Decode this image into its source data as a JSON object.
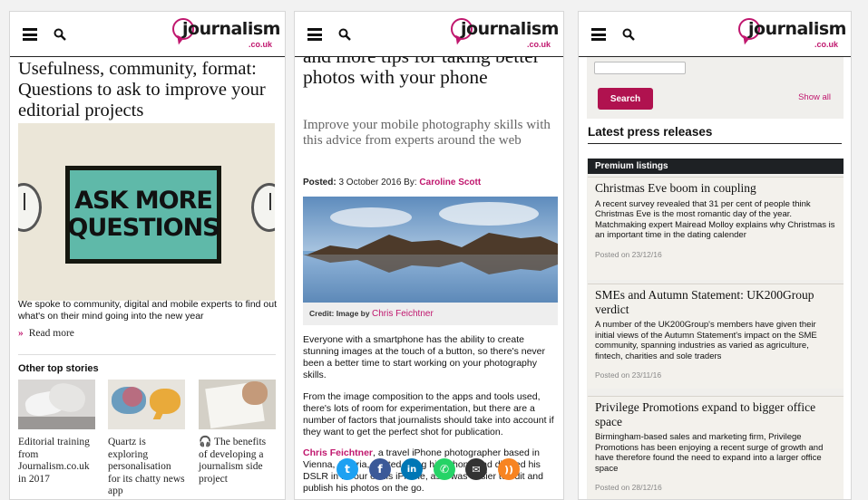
{
  "brand": {
    "name": "journalism",
    "tld": ".co.uk"
  },
  "panel1": {
    "headline": "Usefulness, community, format: Questions to ask to improve your editorial projects",
    "poster_text": [
      "ASK MORE",
      "QUESTIONS"
    ],
    "description": "We spoke to community, digital and mobile experts to find out what's on their mind going into the new year",
    "read_more": "Read more",
    "other_heading": "Other top stories",
    "stories": [
      {
        "title": "Editorial training from Journalism.co.uk in 2017"
      },
      {
        "title": "Quartz is exploring personalisation for its chatty news app"
      },
      {
        "title": "The benefits of developing a journalism side project",
        "icon": "headphones-icon"
      }
    ]
  },
  "panel2": {
    "title": "and more tips for taking better photos with your phone",
    "subtitle": "Improve your mobile photography skills with this advice from experts around the web",
    "posted_label": "Posted:",
    "posted_date": "3 October 2016",
    "by_label": "By:",
    "author": "Caroline Scott",
    "credit_label": "Credit: Image by",
    "credit_name": "Chris Feichtner",
    "p1": "Everyone with a smartphone has the ability to create stunning images at the touch of a button, so there's never been a better time to start working on your photography skills.",
    "p2": "From the image composition to the apps and tools used, there's lots of room for experimentation, but there are a number of factors that journalists should take into account if they want to get the perfect shot for publication.",
    "p3_link": "Chris Feichtner",
    "p3": ", a travel iPhone photographer based in Vienna, Austria, started using his iPhone and ditched his DSLR in favour of his iPhone, as it was easier to edit and publish his photos on the go.",
    "share_icons": [
      "twitter-icon",
      "facebook-icon",
      "linkedin-icon",
      "whatsapp-icon",
      "email-icon",
      "rss-icon"
    ]
  },
  "panel3": {
    "search_button": "Search",
    "show_all": "Show all",
    "latest_heading": "Latest press releases",
    "premium_label": "Premium listings",
    "releases": [
      {
        "title": "Christmas Eve boom in coupling",
        "desc": "A recent survey revealed that 31 per cent of people think Christmas Eve is the most romantic day of the year. Matchmaking expert Mairead Molloy explains why Christmas is an important time in the dating calender",
        "posted": "Posted on 23/12/16"
      },
      {
        "title": "SMEs and Autumn Statement: UK200Group verdict",
        "desc": "A number of the UK200Group's members have given their initial views of the Autumn Statement's impact on the SME community, spanning industries as varied as agriculture, fintech, charities and sole traders",
        "posted": "Posted on 23/11/16"
      },
      {
        "title": "Privilege Promotions expand to bigger office space",
        "desc": "Birmingham-based sales and marketing firm, Privilege Promotions has been enjoying a recent surge of growth and have therefore found the need to expand into a larger office space",
        "posted": "Posted on 28/12/16"
      }
    ]
  },
  "colors": {
    "brand": "#c0176e",
    "button": "#b0124f",
    "premium_bar": "#1e2124"
  }
}
